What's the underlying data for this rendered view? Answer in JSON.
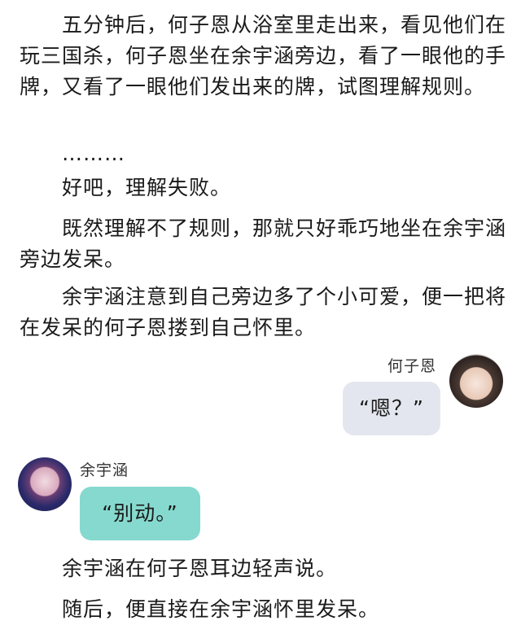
{
  "story": {
    "p1": "五分钟后，何子恩从浴室里走出来，看见他们在玩三国杀，何子恩坐在余宇涵旁边，看了一眼他的手牌，又看了一眼他们发出来的牌，试图理解规则。",
    "p2": "………",
    "p3": "好吧，理解失败。",
    "p4": "既然理解不了规则，那就只好乖巧地坐在余宇涵旁边发呆。",
    "p5": "余宇涵注意到自己旁边多了个小可爱，便一把将在发呆的何子恩搂到自己怀里。",
    "p6": "余宇涵在何子恩耳边轻声说。",
    "p7": "随后，便直接在余宇涵怀里发呆。"
  },
  "chat": {
    "right": {
      "name": "何子恩",
      "message": "“嗯？”",
      "avatar_icon": "girl-portrait-avatar",
      "bubble_color": "#e3e6ee"
    },
    "left": {
      "name": "余宇涵",
      "message": "“别动。”",
      "avatar_icon": "boy-portrait-avatar",
      "bubble_color": "#86d9ce"
    }
  }
}
